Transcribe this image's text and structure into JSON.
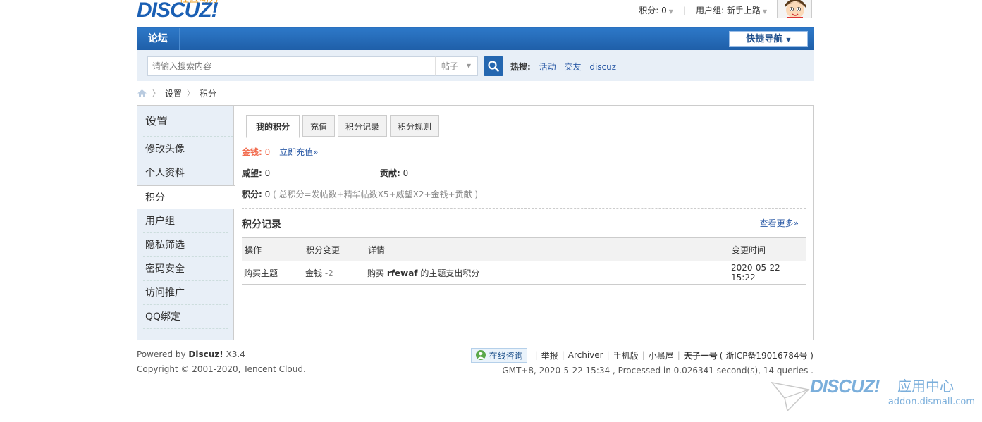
{
  "header": {
    "logo_text": "DISCUZ!",
    "logo_slogan": "社区动力",
    "points_label": "积分: 0",
    "usergroup_label": "用户组: 新手上路"
  },
  "nav": {
    "forum": "论坛",
    "quick_nav": "快捷导航"
  },
  "search": {
    "placeholder": "请输入搜索内容",
    "type": "帖子",
    "hot_label": "热搜:",
    "hot_items": [
      "活动",
      "交友",
      "discuz"
    ]
  },
  "breadcrumb": [
    "设置",
    "积分"
  ],
  "sidebar": {
    "title": "设置",
    "items": [
      "修改头像",
      "个人资料",
      "积分",
      "用户组",
      "隐私筛选",
      "密码安全",
      "访问推广",
      "QQ绑定"
    ],
    "active_index": 2
  },
  "tabs": [
    "我的积分",
    "充值",
    "积分记录",
    "积分规则"
  ],
  "credits": {
    "money_label": "金钱:",
    "money_value": "0",
    "recharge_link": "立即充值»",
    "prestige_label": "威望:",
    "prestige_value": "0",
    "contribution_label": "贡献:",
    "contribution_value": "0",
    "total_label": "积分:",
    "total_value": "0",
    "formula": "( 总积分=发帖数+精华帖数X5+威望X2+金钱+贡献 )"
  },
  "records": {
    "title": "积分记录",
    "more": "查看更多»",
    "columns": [
      "操作",
      "积分变更",
      "详情",
      "变更时间"
    ],
    "rows": [
      {
        "action": "购买主题",
        "change_type": "金钱",
        "change_value": "-2",
        "detail_prefix": "购买",
        "detail_user": "rfewaf",
        "detail_suffix": "的主题支出积分",
        "time": "2020-05-22 15:22"
      }
    ]
  },
  "footer": {
    "powered_prefix": "Powered by",
    "powered_brand": "Discuz!",
    "powered_version": "X3.4",
    "copyright": "Copyright © 2001-2020, Tencent Cloud.",
    "consult": "在线咨询",
    "links": [
      "举报",
      "Archiver",
      "手机版",
      "小黑屋",
      "天子一号"
    ],
    "icp": "( 浙ICP备19016784号 )",
    "runtime": "GMT+8, 2020-5-22 15:34 , Processed in 0.026341 second(s), 14 queries ."
  },
  "watermark": {
    "brand": "DISCUZ!",
    "suffix": "应用中心",
    "domain": "addon.dismall.com"
  },
  "colors": {
    "nav_blue": "#1f5fa9",
    "search_bg": "#e8eff7",
    "link": "#2b5aa6",
    "money": "#f26c4f"
  }
}
